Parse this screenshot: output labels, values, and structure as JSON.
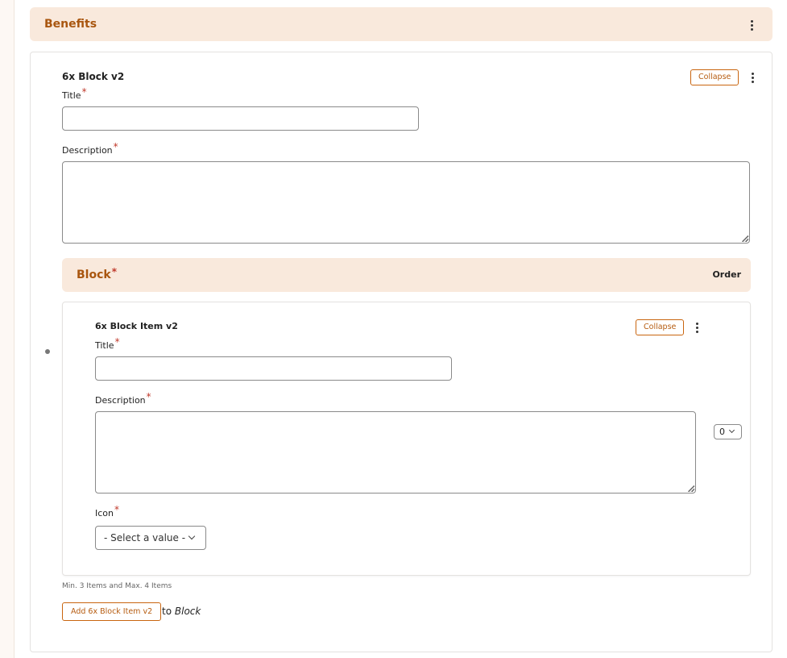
{
  "section": {
    "title": "Benefits"
  },
  "block": {
    "name": "6x Block v2",
    "collapse_label": "Collapse",
    "title_label": "Title",
    "description_label": "Description",
    "title_value": "",
    "description_value": "",
    "required_marker": "*"
  },
  "sub_section": {
    "title": "Block",
    "order_label": "Order"
  },
  "item": {
    "name": "6x Block Item v2",
    "collapse_label": "Collapse",
    "title_label": "Title",
    "description_label": "Description",
    "icon_label": "Icon",
    "title_value": "",
    "description_value": "",
    "icon_selected": "- Select a value -",
    "weight_value": "0"
  },
  "footer": {
    "help_text": "Min. 3 Items and Max. 4 Items",
    "add_button_label": "Add 6x Block Item v2",
    "to_prefix": "to",
    "to_target": "Block"
  },
  "colors": {
    "accent": "#b65c10",
    "header_bg": "#f9e9dc",
    "required": "#c0392b"
  },
  "icons": {
    "menu": "kebab-menu-icon",
    "drag": "drag-handle-icon",
    "dropdown": "chevron-down-icon"
  }
}
